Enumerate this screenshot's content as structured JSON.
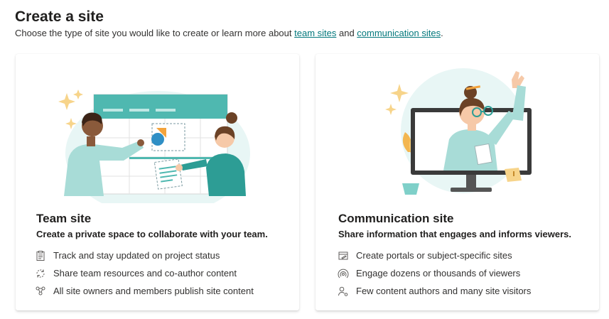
{
  "header": {
    "title": "Create a site",
    "subtitle_prefix": "Choose the type of site you would like to create or learn more about ",
    "link_team": "team sites",
    "subtitle_and": " and ",
    "link_comm": "communication sites",
    "subtitle_suffix": "."
  },
  "cards": [
    {
      "title": "Team site",
      "description": "Create a private space to collaborate with your team.",
      "features": [
        {
          "icon": "clipboard-icon",
          "text": "Track and stay updated on project status"
        },
        {
          "icon": "sync-icon",
          "text": "Share team resources and co-author content"
        },
        {
          "icon": "people-network-icon",
          "text": "All site owners and members publish site content"
        }
      ]
    },
    {
      "title": "Communication site",
      "description": "Share information that engages and informs viewers.",
      "features": [
        {
          "icon": "edit-page-icon",
          "text": "Create portals or subject-specific sites"
        },
        {
          "icon": "broadcast-icon",
          "text": "Engage dozens or thousands of viewers"
        },
        {
          "icon": "person-settings-icon",
          "text": "Few content authors and many site visitors"
        }
      ]
    }
  ],
  "colors": {
    "accent": "#03787c",
    "teal_light": "#c7ecea",
    "teal": "#3fb8af",
    "skin_dark": "#8a5a3b",
    "hair_dark": "#3b2417",
    "star": "#f7d48a",
    "chart_orange": "#f3a33c"
  }
}
